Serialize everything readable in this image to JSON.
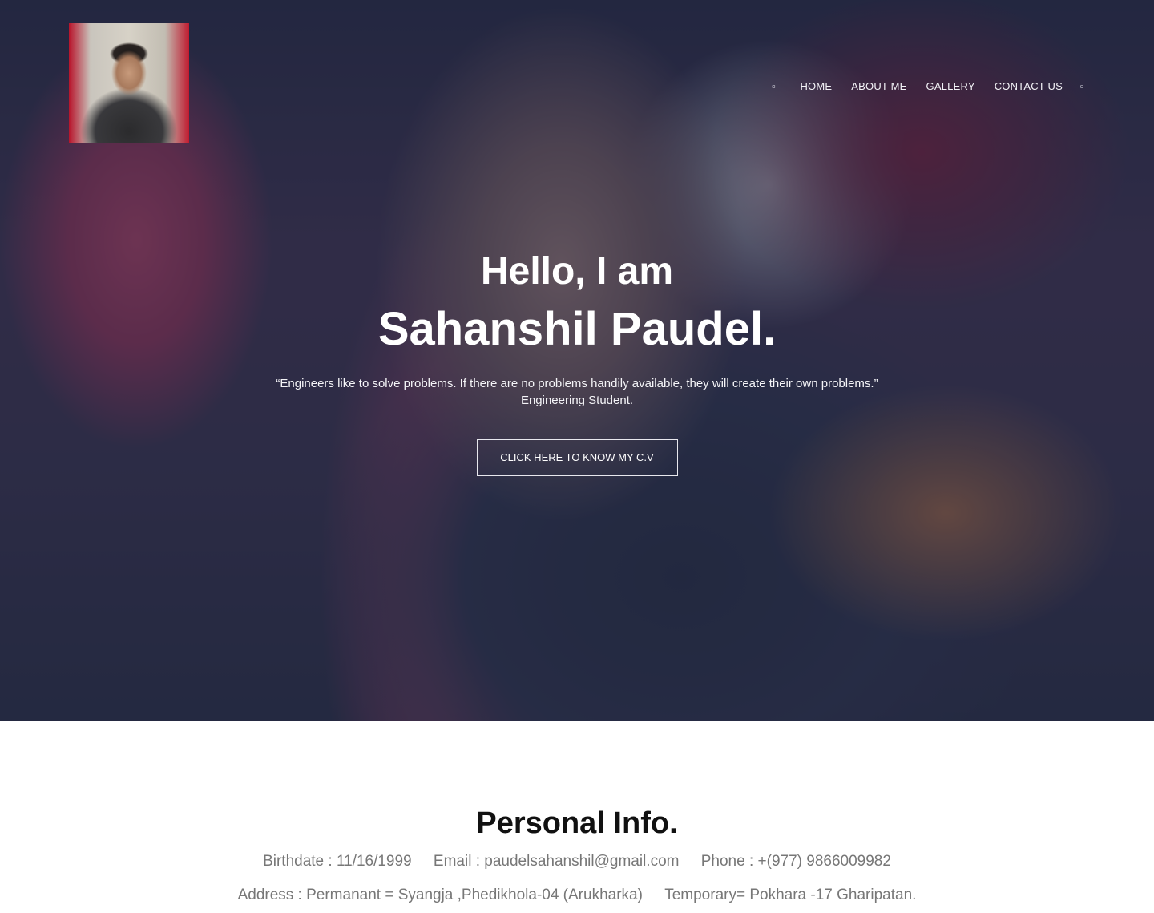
{
  "header": {
    "nav_left_icon": "search-icon",
    "nav_items": [
      "Home",
      "About me",
      "Gallery",
      "Contact Us"
    ],
    "nav_right_icon": "menu-icon"
  },
  "hero": {
    "greeting": "Hello, I am",
    "name": "Sahanshil Paudel.",
    "quote": "“Engineers like to solve problems. If there are no problems handily available, they will create their own problems.” Engineering Student.",
    "cta_label": "click here to know my C.V"
  },
  "personal_info": {
    "title": "Personal Info.",
    "birthdate": "Birthdate : 11/16/1999",
    "email": "Email : paudelsahanshil@gmail.com",
    "phone": "Phone : +(977) 9866009982",
    "address_permanent": "Address : Permanant = Syangja ,Phedikhola-04 (Arukharka)",
    "address_temporary": "Temporary= Pokhara -17 Gharipatan."
  },
  "colors": {
    "overlay": "#1c203a",
    "hero_text": "#ffffff",
    "info_text": "#777777",
    "info_title": "#111111"
  }
}
